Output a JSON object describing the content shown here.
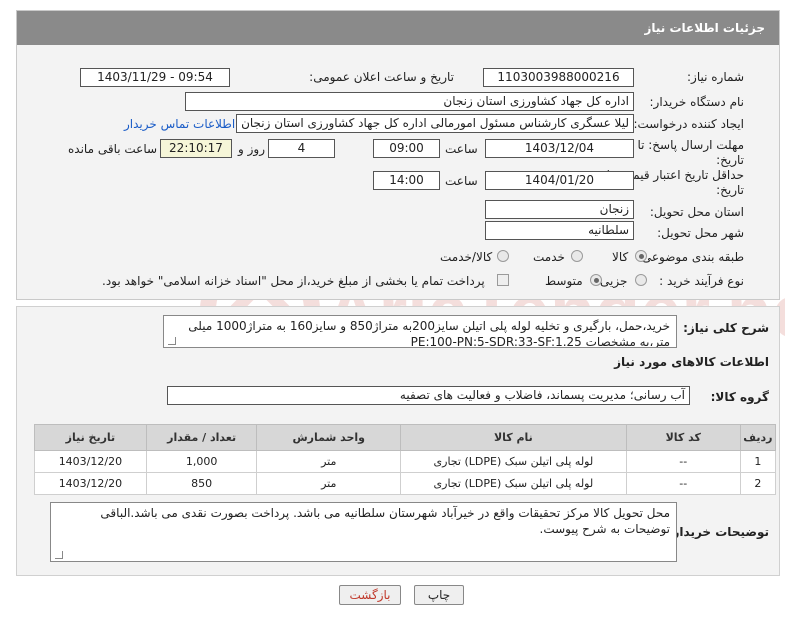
{
  "header": {
    "title": "جزئیات اطلاعات نیاز"
  },
  "fields": {
    "need_number_label": "شماره نیاز:",
    "need_number": "1103003988000216",
    "announce_label": "تاریخ و ساعت اعلان عمومی:",
    "announce_value": "1403/11/29 - 09:54",
    "buyer_org_label": "نام دستگاه خریدار:",
    "buyer_org": "اداره کل جهاد کشاورزی استان زنجان",
    "requester_label": "ایجاد کننده درخواست:",
    "requester": "لیلا عسگری کارشناس مسئول امورمالی اداره کل جهاد کشاورزی استان زنجان",
    "contact_link": "اطلاعات تماس خریدار",
    "deadline_label_1": "مهلت ارسال پاسخ: تا",
    "deadline_label_2": "تاریخ:",
    "deadline_date": "1403/12/04",
    "time_label": "ساعت",
    "deadline_time": "09:00",
    "days_value": "4",
    "days_label": "روز و",
    "remaining_time": "22:10:17",
    "remaining_label": "ساعت باقی مانده",
    "validity_label_1": "حداقل تاریخ اعتبار قیمت: تا",
    "validity_label_2": "تاریخ:",
    "validity_date": "1404/01/20",
    "validity_time": "14:00",
    "province_label": "استان محل تحویل:",
    "province": "زنجان",
    "city_label": "شهر محل تحویل:",
    "city": "سلطانیه",
    "category_label": "طبقه بندی موضوعی:",
    "category_options": [
      "کالا",
      "خدمت",
      "کالا/خدمت"
    ],
    "category_selected": "کالا",
    "process_label": "نوع فرآیند خرید :",
    "process_options": [
      "جزیی",
      "متوسط"
    ],
    "process_selected": "متوسط",
    "payment_note": "پرداخت تمام یا بخشی از مبلغ خرید،از محل \"اسناد خزانه اسلامی\" خواهد بود."
  },
  "details": {
    "description_label": "شرح کلی نیاز:",
    "description": "خرید،حمل، بارگیری و تخلیه لوله پلی اتیلن سایز200به متراژ850 و سایز160 به متراژ1000 میلی متر،به مشخصات PE:100-PN:5-SDR:33-SF:1.25",
    "goods_info_title": "اطلاعات کالاهای مورد نیاز",
    "goods_group_label": "گروه کالا:",
    "goods_group": "آب رسانی؛ مدیریت پسماند، فاضلاب و فعالیت های تصفیه"
  },
  "table": {
    "headers": [
      "ردیف",
      "کد کالا",
      "نام کالا",
      "واحد شمارش",
      "تعداد / مقدار",
      "تاریخ نیاز"
    ],
    "rows": [
      [
        "1",
        "--",
        "لوله پلی اتیلن سبک (LDPE) تجاری",
        "متر",
        "1,000",
        "1403/12/20"
      ],
      [
        "2",
        "--",
        "لوله پلی اتیلن سبک (LDPE) تجاری",
        "متر",
        "850",
        "1403/12/20"
      ]
    ]
  },
  "buyer_notes": {
    "label": "توضیحات خریدار:",
    "text": "محل تحویل کالا مرکز تحقیقات واقع در خیرآباد شهرستان سلطانیه می باشد. پرداخت بصورت نقدی می باشد.الباقی توضیحات به شرح پیوست."
  },
  "buttons": {
    "print": "چاپ",
    "back": "بازگشت"
  },
  "watermark": {
    "text": "AriaTender.neT"
  },
  "colors": {
    "header_bg": "#8a8a8a",
    "link": "#1a5cc7",
    "back_text": "#c0392b"
  }
}
